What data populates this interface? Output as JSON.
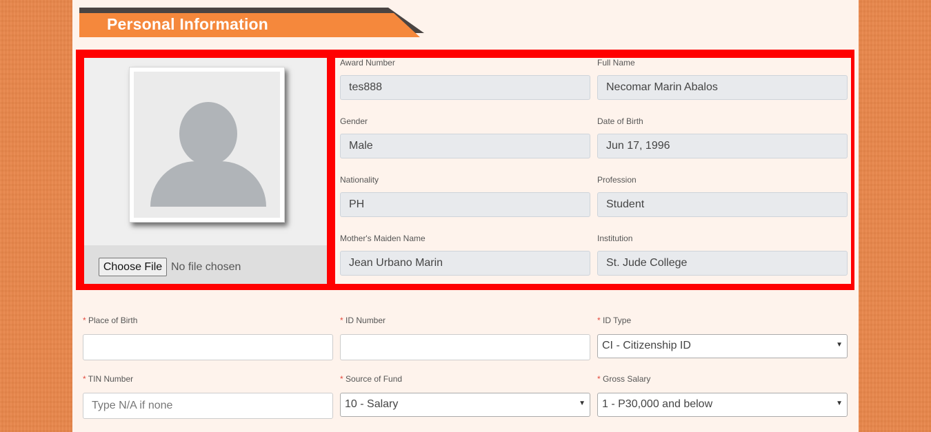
{
  "section": {
    "title": "Personal Information"
  },
  "photo": {
    "choose_file_label": "Choose File",
    "file_status": "No file chosen"
  },
  "readonly_fields": [
    {
      "label": "Award Number",
      "value": "tes888"
    },
    {
      "label": "Full Name",
      "value": "Necomar Marin Abalos"
    },
    {
      "label": "Gender",
      "value": "Male"
    },
    {
      "label": "Date of Birth",
      "value": "Jun 17, 1996"
    },
    {
      "label": "Nationality",
      "value": "PH"
    },
    {
      "label": "Profession",
      "value": "Student"
    },
    {
      "label": "Mother's Maiden Name",
      "value": "Jean Urbano Marin"
    },
    {
      "label": "Institution",
      "value": "St. Jude College"
    }
  ],
  "form": {
    "required_marker": "*",
    "place_of_birth": {
      "label": "Place of Birth",
      "value": "",
      "placeholder": ""
    },
    "id_number": {
      "label": "ID Number",
      "value": "",
      "placeholder": ""
    },
    "id_type": {
      "label": "ID Type",
      "selected": "CI - Citizenship ID"
    },
    "tin_number": {
      "label": "TIN Number",
      "value": "",
      "placeholder": "Type N/A if none"
    },
    "source_of_fund": {
      "label": "Source of Fund",
      "selected": "10 - Salary"
    },
    "gross_salary": {
      "label": "Gross Salary",
      "selected": "1 - P30,000 and below"
    }
  },
  "colors": {
    "accent_orange": "#f5883c",
    "highlight_red": "#ff0000",
    "required_red": "#e34b3e"
  },
  "icons": {
    "dropdown_arrow": "▼"
  }
}
